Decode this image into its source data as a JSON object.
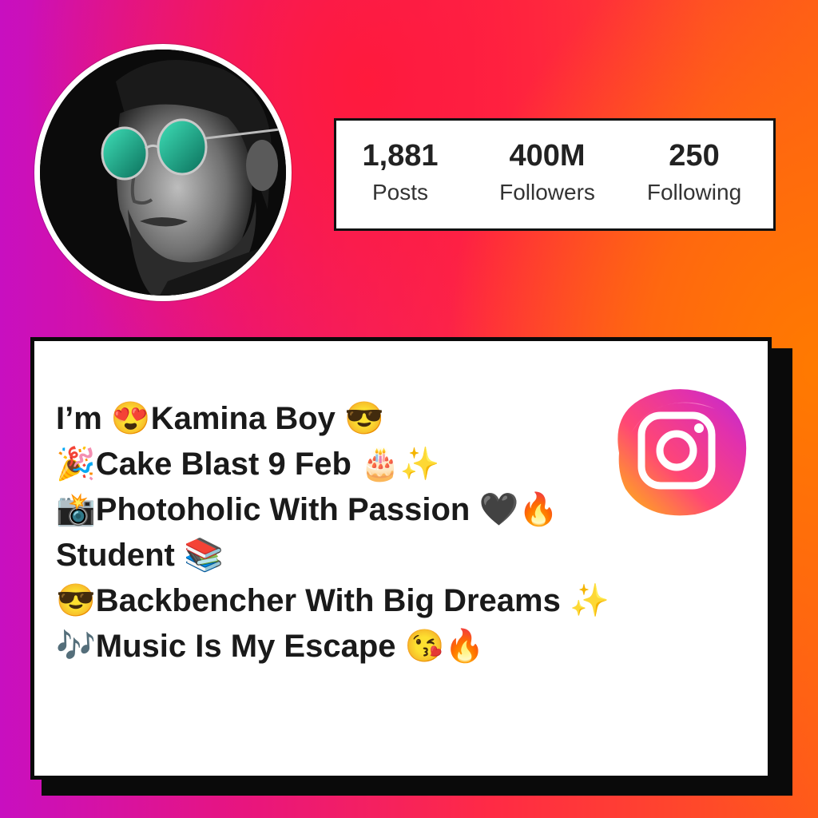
{
  "profile": {
    "avatar_alt": "profile photo",
    "stats": [
      {
        "value": "1,881",
        "label": "Posts"
      },
      {
        "value": "400M",
        "label": "Followers"
      },
      {
        "value": "250",
        "label": "Following"
      }
    ]
  },
  "bio": {
    "lines": [
      "I’m 😍Kamina Boy 😎",
      "🎉Cake Blast 9 Feb 🎂✨",
      "📸Photoholic With Passion 🖤🔥",
      "Student 📚",
      "😎Backbencher With Big Dreams ✨",
      "🎶Music Is My Escape 😘🔥"
    ]
  },
  "logo": {
    "icon": "instagram-icon"
  },
  "colors": {
    "background_left": "#c80fc0",
    "background_mid": "#ff2a45",
    "background_right": "#ff7a00",
    "card": "#ffffff",
    "card_border": "#0a0a0a",
    "text": "#1a1a1a",
    "lens": "#1aa98a"
  }
}
